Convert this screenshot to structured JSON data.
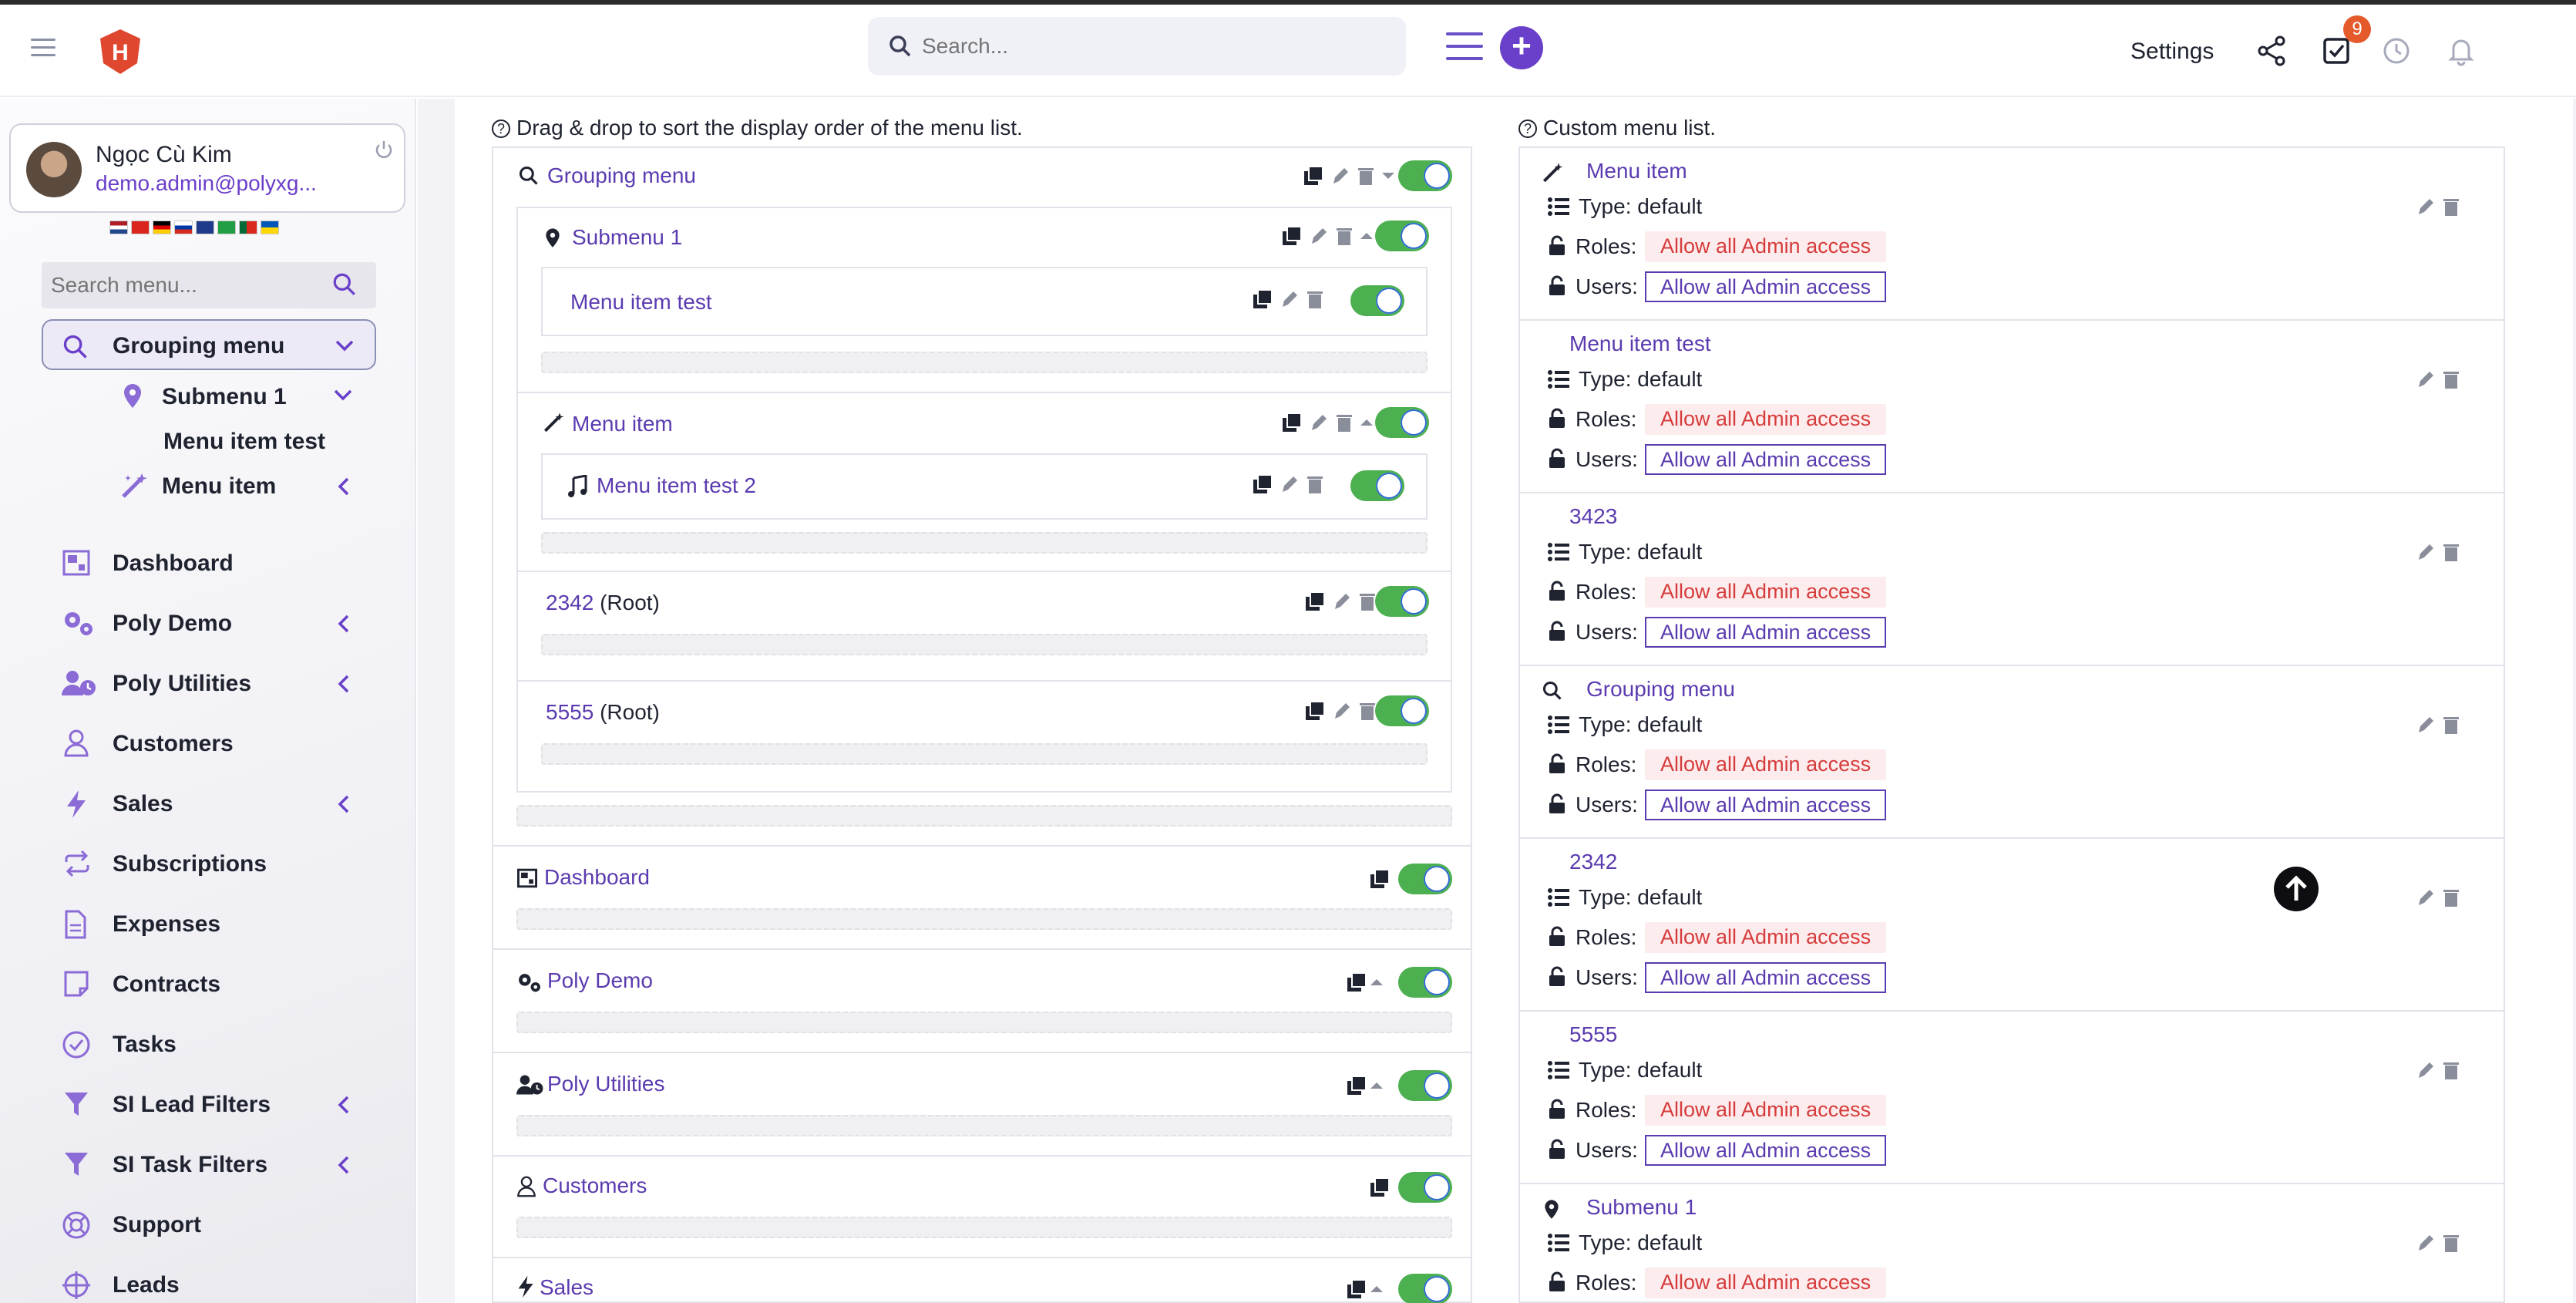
{
  "header": {
    "search_placeholder": "Search...",
    "settings_label": "Settings",
    "tasks_badge": "9",
    "plus_label": "+"
  },
  "user": {
    "name": "Ngọc Cù Kim",
    "email": "demo.admin@polyxg..."
  },
  "sidebar": {
    "search_placeholder": "Search menu...",
    "active_group": "Grouping menu",
    "sub": [
      {
        "label": "Submenu 1"
      },
      {
        "label": "Menu item test"
      },
      {
        "label": "Menu item"
      }
    ],
    "items": [
      {
        "label": "Dashboard",
        "icon": "dashboard-icon"
      },
      {
        "label": "Poly Demo",
        "icon": "gears-icon"
      },
      {
        "label": "Poly Utilities",
        "icon": "user-clock-icon"
      },
      {
        "label": "Customers",
        "icon": "user-icon"
      },
      {
        "label": "Sales",
        "icon": "bolt-icon"
      },
      {
        "label": "Subscriptions",
        "icon": "repeat-icon"
      },
      {
        "label": "Expenses",
        "icon": "file-icon"
      },
      {
        "label": "Contracts",
        "icon": "note-icon"
      },
      {
        "label": "Tasks",
        "icon": "check-circle-icon"
      },
      {
        "label": "SI Lead Filters",
        "icon": "filter-icon"
      },
      {
        "label": "SI Task Filters",
        "icon": "filter-icon"
      },
      {
        "label": "Support",
        "icon": "lifebuoy-icon"
      },
      {
        "label": "Leads",
        "icon": "crosshair-icon"
      }
    ]
  },
  "left_panel": {
    "hint": "Drag & drop to sort the display order of the menu list.",
    "grouping_menu": "Grouping menu",
    "submenu1": "Submenu 1",
    "menu_item_test": "Menu item test",
    "menu_item": "Menu item",
    "menu_item_test2": "Menu item test 2",
    "r2342": "2342",
    "r5555": "5555",
    "root_suffix": "(Root)",
    "dashboard": "Dashboard",
    "poly_demo": "Poly Demo",
    "poly_utilities": "Poly Utilities",
    "customers": "Customers",
    "sales": "Sales"
  },
  "right_panel": {
    "hint": "Custom menu list.",
    "type_label": "Type: default",
    "roles_label": "Roles:",
    "users_label": "Users:",
    "allow_label": "Allow all Admin access",
    "cards": [
      {
        "title": "Menu item",
        "icon": "magic-wand-icon"
      },
      {
        "title": "Menu item test",
        "icon": ""
      },
      {
        "title": "3423",
        "icon": ""
      },
      {
        "title": "Grouping menu",
        "icon": "search-icon"
      },
      {
        "title": "2342",
        "icon": ""
      },
      {
        "title": "5555",
        "icon": ""
      },
      {
        "title": "Submenu 1",
        "icon": "map-pin-icon"
      }
    ]
  },
  "colors": {
    "accent": "#6a3fc9",
    "toggle_on": "#4caf50",
    "danger": "#d63b3b"
  }
}
